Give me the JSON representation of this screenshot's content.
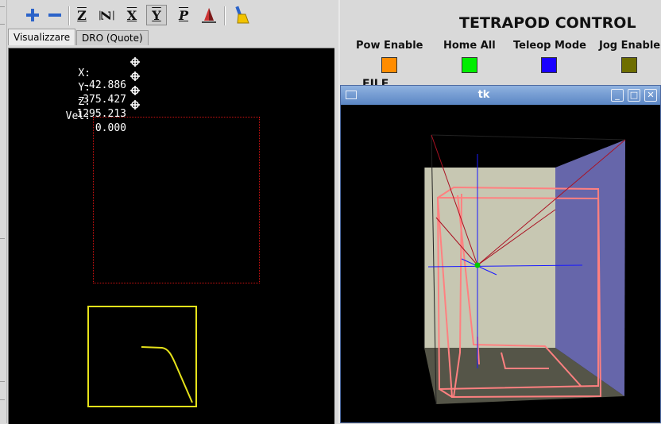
{
  "toolbar": {
    "buttons": [
      {
        "icon": "zoom-in-icon"
      },
      {
        "icon": "zoom-out-icon"
      },
      {
        "icon": "view-z-icon",
        "glyph": "Z"
      },
      {
        "icon": "view-z-rotated-icon",
        "glyph": "Z"
      },
      {
        "icon": "view-x-icon",
        "glyph": "X"
      },
      {
        "icon": "view-y-icon",
        "glyph": "Y"
      },
      {
        "icon": "view-p-icon",
        "glyph": "P"
      },
      {
        "icon": "rotate-view-icon"
      },
      {
        "icon": "clear-plot-icon"
      }
    ]
  },
  "tabs": [
    {
      "label": "Visualizzare",
      "active": true
    },
    {
      "label": "DRO (Quote)",
      "active": false
    }
  ],
  "dro": {
    "rows": [
      {
        "label": "X:",
        "value": "-42.886"
      },
      {
        "label": "Y:",
        "value": "-375.427"
      },
      {
        "label": "Z:",
        "value": "1295.213"
      },
      {
        "label": "Vel:",
        "value": "0.000"
      }
    ]
  },
  "panel": {
    "title": "TETRAPOD CONTROL",
    "controls": [
      {
        "label": "Pow Enable",
        "color": "#ff8c00"
      },
      {
        "label": "Home All",
        "color": "#00ee00"
      },
      {
        "label": "Teleop Mode",
        "color": "#1a00ff"
      },
      {
        "label": "Jog Enable",
        "color": "#6e6e00"
      }
    ],
    "file_label": "FILE"
  },
  "tk_window": {
    "title": "tk",
    "buttons": [
      "minimize-icon",
      "maximize-icon",
      "close-icon"
    ]
  },
  "colors": {
    "limit_box": "#cc1111",
    "preview_path": "#e6e21a",
    "back_wall": "#c7c7b2",
    "side_wall": "#6666aa",
    "floor": "#555548",
    "workspace": "#ff8080",
    "cables": "#aa1122",
    "axes": "#1a1aff"
  }
}
